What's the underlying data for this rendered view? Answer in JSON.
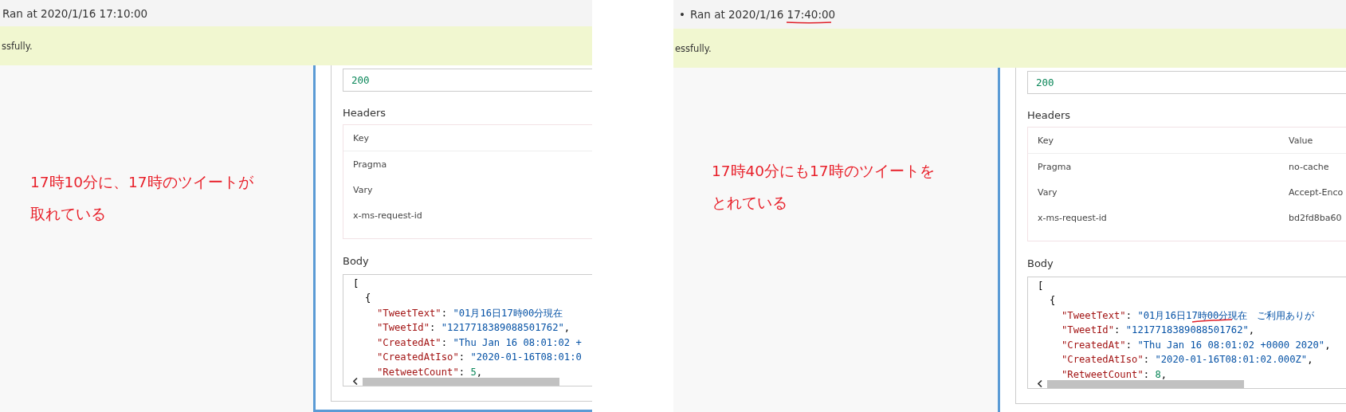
{
  "panels": [
    {
      "ran_at": "Ran at 2020/1/16 17:10:00",
      "banner": "ssfully.",
      "annotation": [
        "17時10分に、17時のツイートが",
        "取れている"
      ],
      "status_code": "200",
      "headers_title": "Headers",
      "headers_columns": [
        "Key"
      ],
      "headers_rows": [
        [
          "Pragma"
        ],
        [
          "Vary"
        ],
        [
          "x-ms-request-id"
        ]
      ],
      "body_title": "Body",
      "code": [
        {
          "segments": [
            {
              "kind": "punct",
              "text": "["
            }
          ],
          "children": [
            {
              "segments": [
                {
                  "kind": "punct",
                  "text": "{"
                }
              ],
              "children": [
                {
                  "segments": [
                    {
                      "kind": "key",
                      "text": "\"TweetText\""
                    },
                    {
                      "kind": "punct",
                      "text": ": "
                    },
                    {
                      "kind": "string",
                      "text": "\"01月16日17時00分現在"
                    }
                  ]
                },
                {
                  "segments": [
                    {
                      "kind": "key",
                      "text": "\"TweetId\""
                    },
                    {
                      "kind": "punct",
                      "text": ": "
                    },
                    {
                      "kind": "string",
                      "text": "\"1217718389088501762\""
                    },
                    {
                      "kind": "punct",
                      "text": ","
                    }
                  ]
                },
                {
                  "segments": [
                    {
                      "kind": "key",
                      "text": "\"CreatedAt\""
                    },
                    {
                      "kind": "punct",
                      "text": ": "
                    },
                    {
                      "kind": "string",
                      "text": "\"Thu Jan 16 08:01:02 +"
                    }
                  ]
                },
                {
                  "segments": [
                    {
                      "kind": "key",
                      "text": "\"CreatedAtIso\""
                    },
                    {
                      "kind": "punct",
                      "text": ": "
                    },
                    {
                      "kind": "string",
                      "text": "\"2020-01-16T08:01:0"
                    }
                  ]
                },
                {
                  "segments": [
                    {
                      "kind": "key",
                      "text": "\"RetweetCount\""
                    },
                    {
                      "kind": "punct",
                      "text": ": "
                    },
                    {
                      "kind": "number",
                      "text": "5"
                    },
                    {
                      "kind": "punct",
                      "text": ","
                    }
                  ]
                }
              ]
            }
          ]
        }
      ]
    },
    {
      "bullet": "•",
      "ran_at": "Ran at 2020/1/16 17:40:00",
      "underlined": true,
      "banner": "essfully.",
      "annotation": [
        "17時40分にも17時のツイートを",
        "とれている"
      ],
      "status_code": "200",
      "headers_title": "Headers",
      "headers_columns": [
        "Key",
        "Value"
      ],
      "headers_rows": [
        [
          "Pragma",
          "no-cache"
        ],
        [
          "Vary",
          "Accept-Enco"
        ],
        [
          "x-ms-request-id",
          "bd2fd8ba60"
        ]
      ],
      "body_title": "Body",
      "code": [
        {
          "segments": [
            {
              "kind": "punct",
              "text": "["
            }
          ],
          "children": [
            {
              "segments": [
                {
                  "kind": "punct",
                  "text": "{"
                }
              ],
              "children": [
                {
                  "segments": [
                    {
                      "kind": "key",
                      "text": "\"TweetText\""
                    },
                    {
                      "kind": "punct",
                      "text": ": "
                    },
                    {
                      "kind": "string",
                      "text": "\"01月16日17時00分現在　ご利用ありが"
                    }
                  ]
                },
                {
                  "segments": [
                    {
                      "kind": "key",
                      "text": "\"TweetId\""
                    },
                    {
                      "kind": "punct",
                      "text": ": "
                    },
                    {
                      "kind": "string",
                      "text": "\"1217718389088501762\""
                    },
                    {
                      "kind": "punct",
                      "text": ","
                    }
                  ]
                },
                {
                  "segments": [
                    {
                      "kind": "key",
                      "text": "\"CreatedAt\""
                    },
                    {
                      "kind": "punct",
                      "text": ": "
                    },
                    {
                      "kind": "string",
                      "text": "\"Thu Jan 16 08:01:02 +0000 2020\""
                    },
                    {
                      "kind": "punct",
                      "text": ","
                    }
                  ]
                },
                {
                  "segments": [
                    {
                      "kind": "key",
                      "text": "\"CreatedAtIso\""
                    },
                    {
                      "kind": "punct",
                      "text": ": "
                    },
                    {
                      "kind": "string",
                      "text": "\"2020-01-16T08:01:02.000Z\""
                    },
                    {
                      "kind": "punct",
                      "text": ","
                    }
                  ]
                },
                {
                  "segments": [
                    {
                      "kind": "key",
                      "text": "\"RetweetCount\""
                    },
                    {
                      "kind": "punct",
                      "text": ": "
                    },
                    {
                      "kind": "number",
                      "text": "8"
                    },
                    {
                      "kind": "punct",
                      "text": ","
                    }
                  ]
                }
              ]
            }
          ]
        }
      ]
    }
  ]
}
